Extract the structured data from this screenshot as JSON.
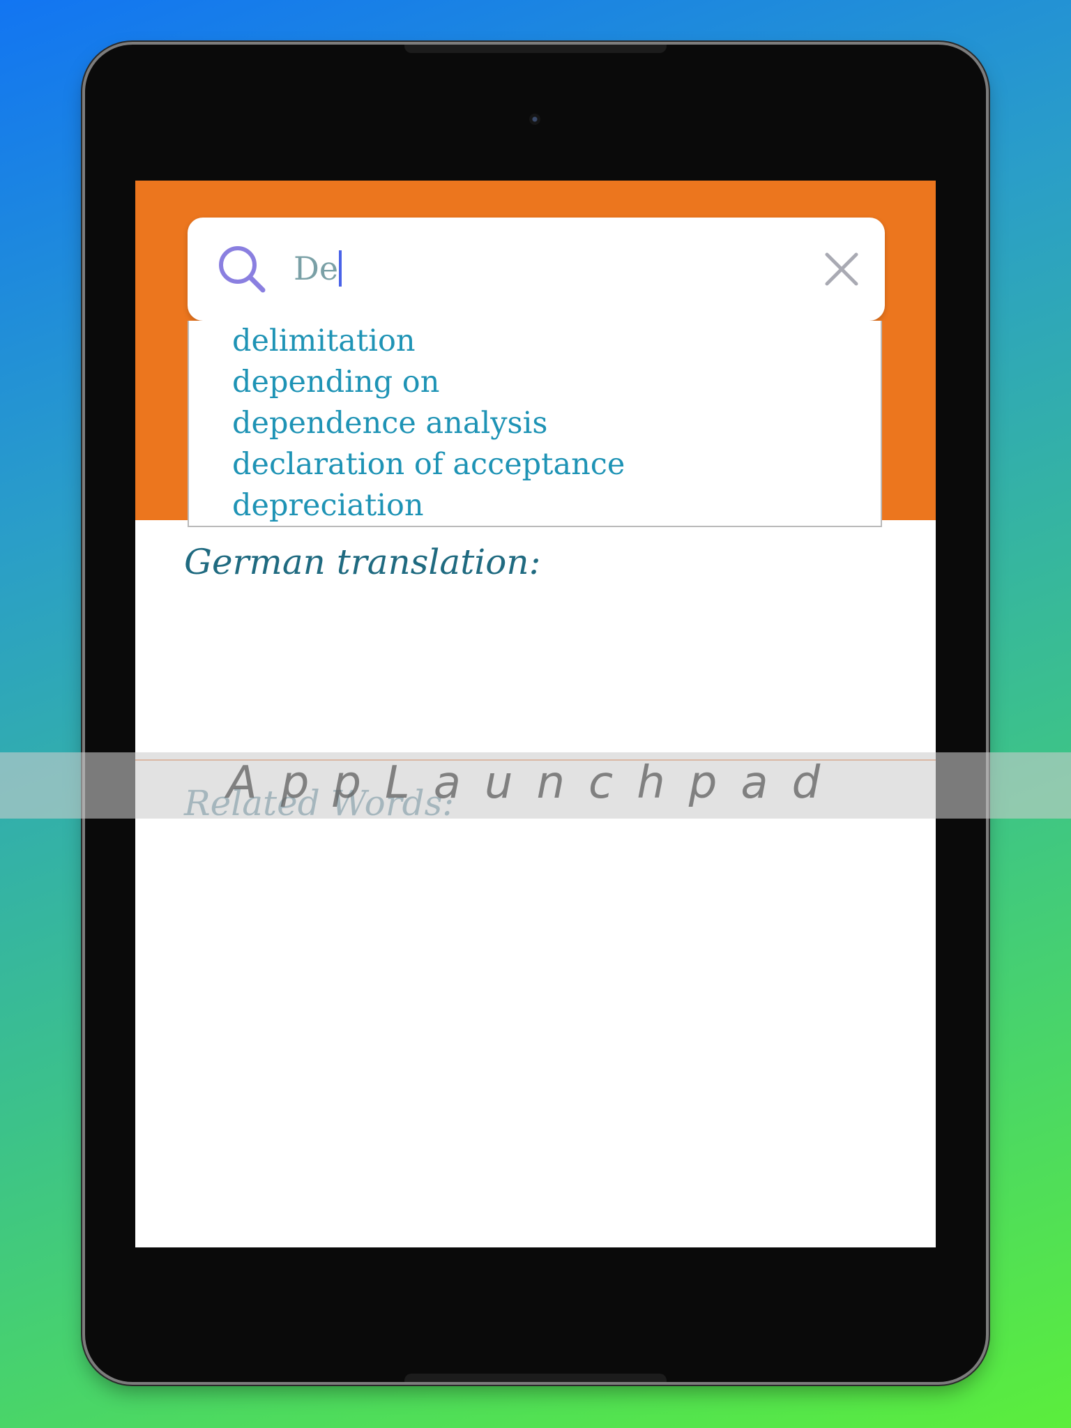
{
  "search": {
    "value": "De",
    "icon": "search-icon",
    "clear_icon": "close-icon",
    "icon_color": "#8a7fe0"
  },
  "suggestions": [
    "delimitation",
    "depending on",
    "dependence analysis",
    "declaration of acceptance",
    "depreciation"
  ],
  "sections": {
    "german_translation_label": "German translation:",
    "related_words_label": "Related Words:"
  },
  "watermark": {
    "text": "AppLaunchpad"
  },
  "colors": {
    "accent": "#ec761e",
    "suggestion_text": "#1e93b5",
    "label_text": "#1f6a80"
  }
}
